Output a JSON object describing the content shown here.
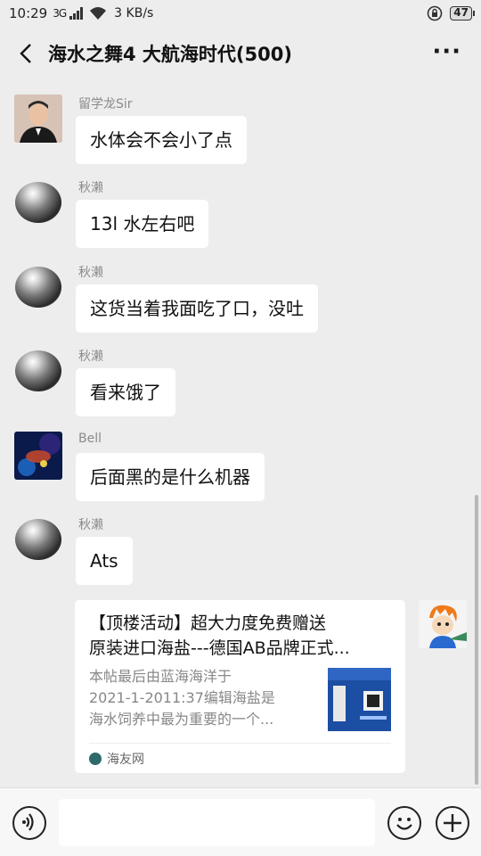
{
  "status_bar": {
    "time": "10:29",
    "signal": "3G",
    "speed": "3 KB/s",
    "battery": "47"
  },
  "header": {
    "title": "海水之舞4 大航海时代(500)"
  },
  "messages": [
    {
      "sender": "留学龙Sir",
      "text": "水体会不会小了点",
      "avatar": "person-photo"
    },
    {
      "sender": "秋濑",
      "text": "13l 水左右吧",
      "avatar": "chrome-ball"
    },
    {
      "sender": "秋濑",
      "text": "这货当着我面吃了口，没吐",
      "avatar": "chrome-ball"
    },
    {
      "sender": "秋濑",
      "text": "看来饿了",
      "avatar": "chrome-ball"
    },
    {
      "sender": "Bell",
      "text": "后面黑的是什么机器",
      "avatar": "aquarium-photo"
    },
    {
      "sender": "秋濑",
      "text": "Ats",
      "avatar": "chrome-ball"
    }
  ],
  "card": {
    "title_line1": "【顶楼活动】超大力度免费赠送",
    "title_line2": "原装进口海盐---德国AB品牌正式...",
    "desc_line1": "本帖最后由蓝海海洋于",
    "desc_line2": "2021-1-2011:37编辑海盐是",
    "desc_line3": "海水饲养中最为重要的一个...",
    "source": "海友网"
  },
  "icons": {
    "back": "back-arrow-icon",
    "more": "more-icon",
    "voice": "voice-icon",
    "emoji": "emoji-icon",
    "plus": "plus-icon"
  }
}
